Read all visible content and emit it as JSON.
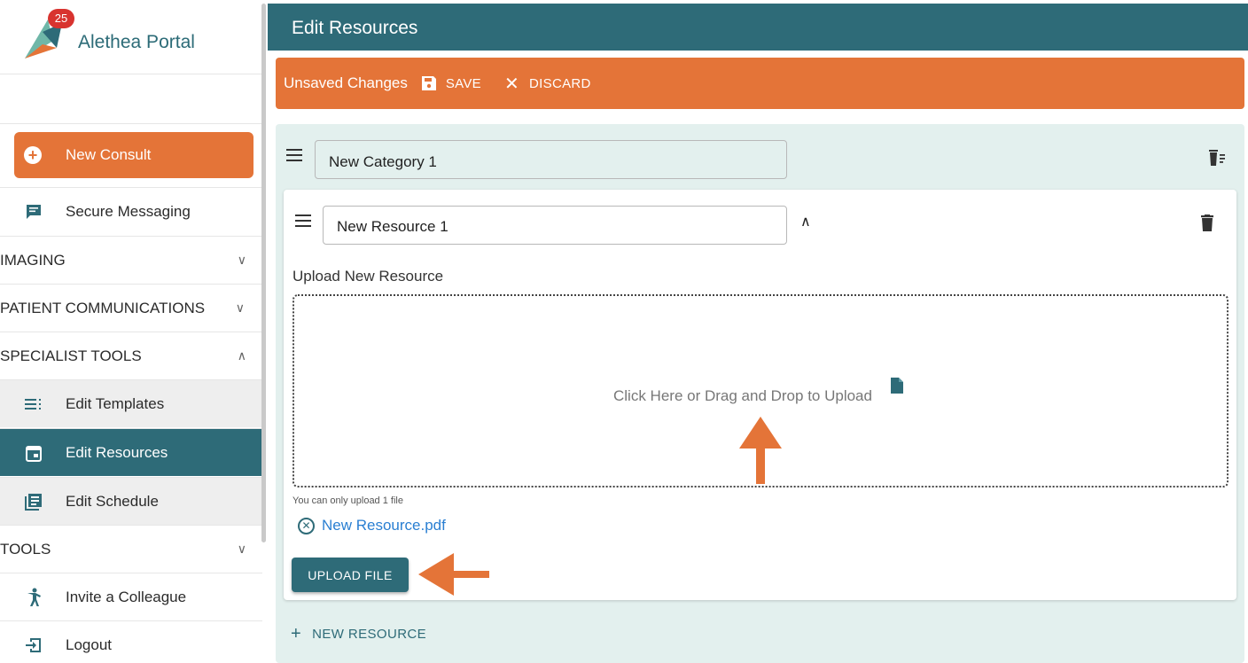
{
  "app": {
    "title": "Alethea Portal",
    "notification_count": "25"
  },
  "sidebar": {
    "new_consult": "New Consult",
    "items": [
      {
        "label": "Secure Messaging",
        "icon": "message-icon"
      },
      {
        "label": "IMAGING",
        "expanded": false
      },
      {
        "label": "PATIENT COMMUNICATIONS",
        "expanded": false
      },
      {
        "label": "SPECIALIST TOOLS",
        "expanded": true
      },
      {
        "label": "Edit Templates",
        "icon": "list-icon"
      },
      {
        "label": "Edit Resources",
        "icon": "calendar-icon",
        "active": true
      },
      {
        "label": "Edit Schedule",
        "icon": "schedule-icon"
      },
      {
        "label": "TOOLS",
        "expanded": false
      },
      {
        "label": "Invite a Colleague",
        "icon": "person-icon"
      },
      {
        "label": "Logout",
        "icon": "logout-icon"
      }
    ]
  },
  "header": {
    "title": "Edit Resources"
  },
  "unsaved_bar": {
    "message": "Unsaved Changes",
    "save_label": "SAVE",
    "discard_label": "DISCARD"
  },
  "category": {
    "name": "New Category 1"
  },
  "resource": {
    "name": "New Resource 1",
    "upload_label": "Upload New Resource",
    "dropzone_text": "Click Here or Drag and Drop to Upload",
    "hint": "You can only upload 1 file",
    "file_name": "New Resource.pdf",
    "upload_button": "UPLOAD FILE"
  },
  "new_resource_label": "NEW RESOURCE",
  "colors": {
    "teal": "#2e6b78",
    "orange": "#e47438",
    "panel": "#e3f0ee",
    "badge": "#d8332f"
  }
}
